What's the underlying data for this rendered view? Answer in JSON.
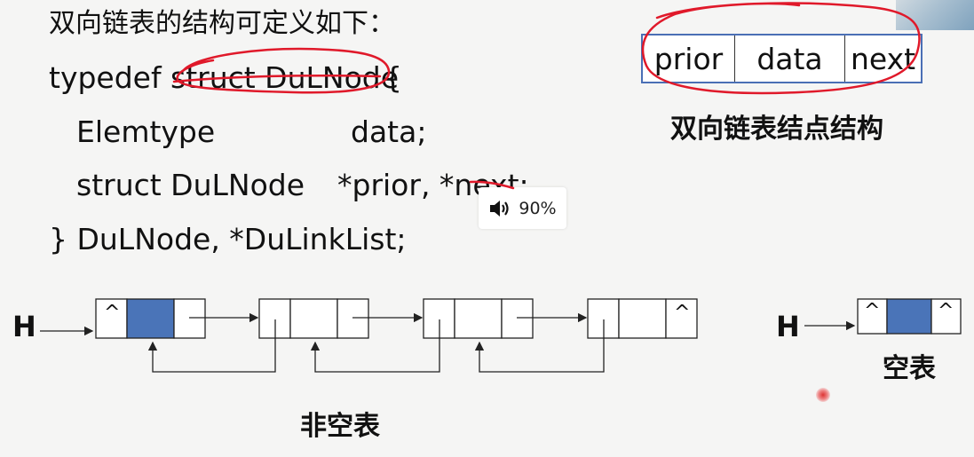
{
  "heading": "双向链表的结构可定义如下：",
  "code": {
    "line1_kw": "typedef",
    "line1_struct": "struct DuLNode",
    "line1_brace": "{",
    "line2_type": "Elemtype",
    "line2_field": "data;",
    "line3_type": "struct DuLNode",
    "line3_field": "*prior, *next;",
    "line4": "} DuLNode, *DuLinkList;"
  },
  "node_structure": {
    "cells": [
      "prior",
      "data",
      "next"
    ],
    "caption": "双向链表结点结构"
  },
  "volume": {
    "icon": "speaker-icon",
    "level": "90%"
  },
  "diagram": {
    "head_label": "H",
    "null_symbol": "^",
    "nonempty_caption": "非空表",
    "empty_caption": "空表"
  },
  "colors": {
    "data_cell": "#4a74b8",
    "annotation": "#e0192a",
    "table_border": "#4a6fb5"
  }
}
